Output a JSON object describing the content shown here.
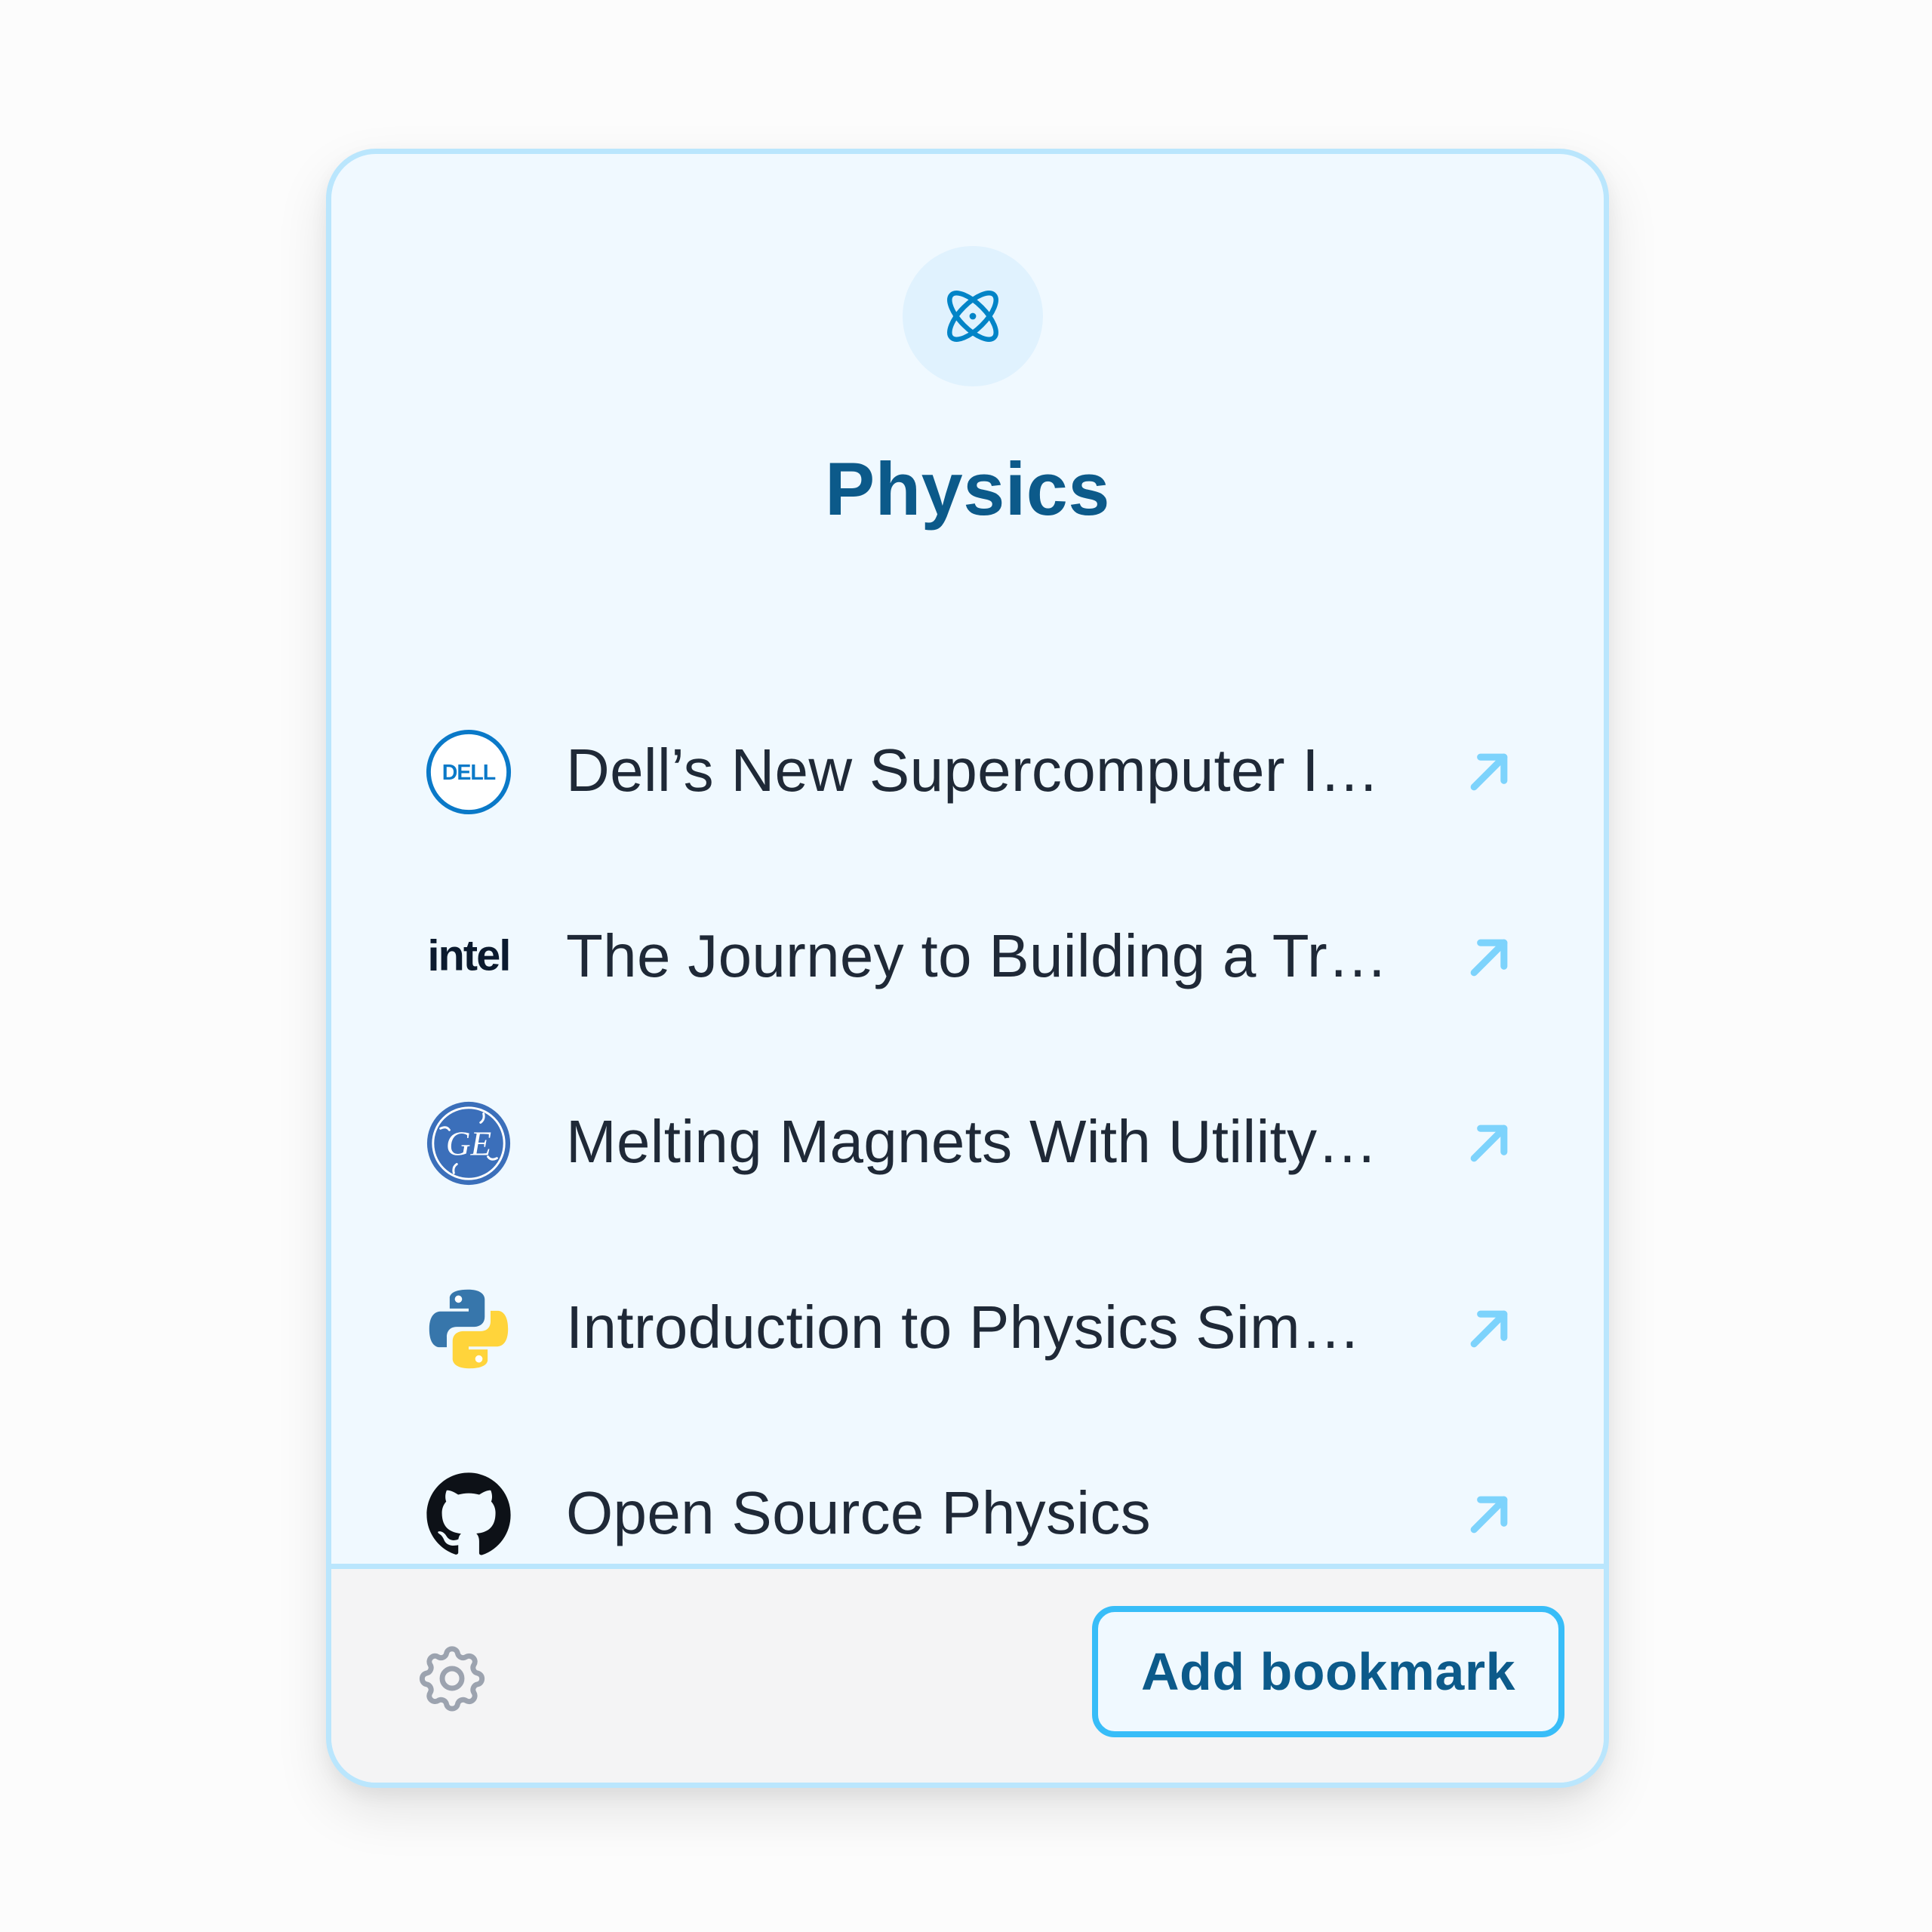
{
  "folder": {
    "icon": "atom-icon",
    "title": "Physics"
  },
  "bookmarks": [
    {
      "logo": "dell-logo",
      "logo_text": "DELL",
      "title": "Dell’s New Supercomputer I…",
      "action_icon": "arrow-up-right-icon"
    },
    {
      "logo": "intel-logo",
      "logo_text": "intel",
      "title": "The Journey to Building a Tr…",
      "action_icon": "arrow-up-right-icon"
    },
    {
      "logo": "ge-logo",
      "logo_text": "GE",
      "title": "Melting Magnets With Utility…",
      "action_icon": "arrow-up-right-icon"
    },
    {
      "logo": "python-logo",
      "title": "Introduction to Physics Sim…",
      "action_icon": "arrow-up-right-icon"
    },
    {
      "logo": "github-logo",
      "title": "Open Source Physics",
      "action_icon": "arrow-up-right-icon"
    }
  ],
  "footer": {
    "settings_icon": "gear-icon",
    "add_button_label": "Add bookmark"
  },
  "colors": {
    "card_background": "#f0f9ff",
    "card_border": "#bae6fd",
    "title": "#0c5a8a",
    "accent": "#38bdf8",
    "arrow": "#7dd3fc",
    "footer_background": "#f4f4f5"
  }
}
